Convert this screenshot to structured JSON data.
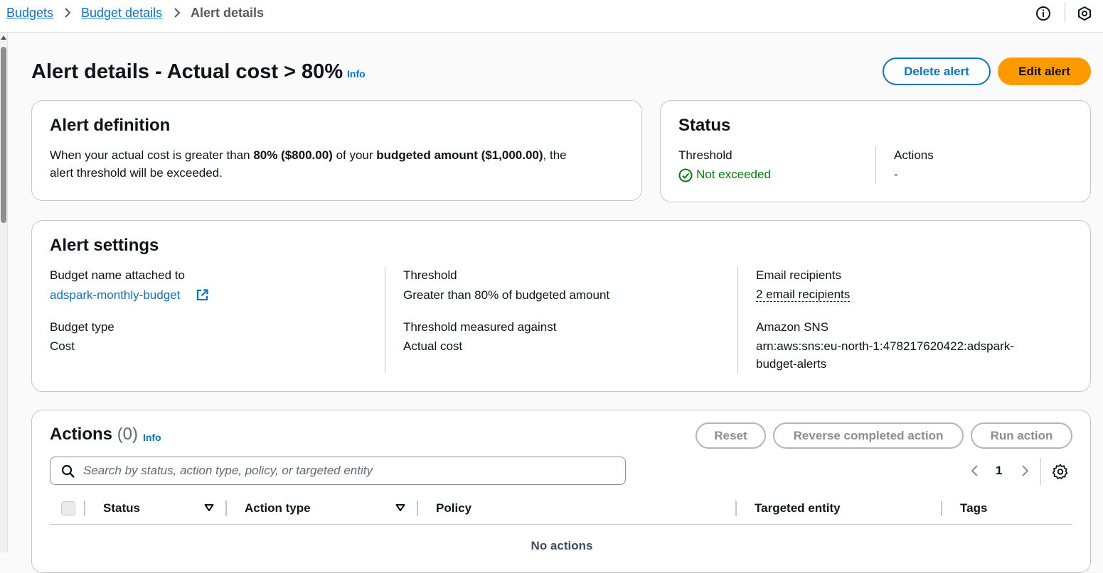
{
  "breadcrumb": {
    "items": [
      "Budgets",
      "Budget details"
    ],
    "current": "Alert details"
  },
  "page": {
    "title": "Alert details - Actual cost > 80%",
    "info": "Info",
    "delete_label": "Delete alert",
    "edit_label": "Edit alert"
  },
  "alert_definition": {
    "heading": "Alert definition",
    "text_1": "When your actual cost is greater than ",
    "bold_1": "80% ($800.00)",
    "text_2": " of your ",
    "bold_2": "budgeted amount ($1,000.00)",
    "text_3": ", the",
    "line_2": "alert threshold will be exceeded."
  },
  "status": {
    "heading": "Status",
    "threshold_label": "Threshold",
    "threshold_value": "Not exceeded",
    "actions_label": "Actions",
    "actions_value": "-",
    "ok_color": "#037f0c"
  },
  "alert_settings": {
    "heading": "Alert settings",
    "budget_name_label": "Budget name attached to",
    "budget_name_value": "adspark-monthly-budget",
    "budget_type_label": "Budget type",
    "budget_type_value": "Cost",
    "threshold_label": "Threshold",
    "threshold_value": "Greater than 80% of budgeted amount",
    "measured_label": "Threshold measured against",
    "measured_value": "Actual cost",
    "email_label": "Email recipients",
    "email_value": "2 email recipients",
    "sns_label": "Amazon SNS",
    "sns_value_1": "arn:aws:sns:eu-north-1:478217620422:adspark-",
    "sns_value_2": "budget-alerts"
  },
  "actions": {
    "heading": "Actions",
    "count": "(0)",
    "info": "Info",
    "reset_label": "Reset",
    "reverse_label": "Reverse completed action",
    "run_label": "Run action",
    "search_placeholder": "Search by status, action type, policy, or targeted entity",
    "page_number": "1",
    "columns": [
      "Status",
      "Action type",
      "Policy",
      "Targeted entity",
      "Tags"
    ],
    "empty_text": "No actions"
  },
  "colors": {
    "link": "#0972d3",
    "primary": "#ff9900",
    "text": "#0f141a"
  }
}
